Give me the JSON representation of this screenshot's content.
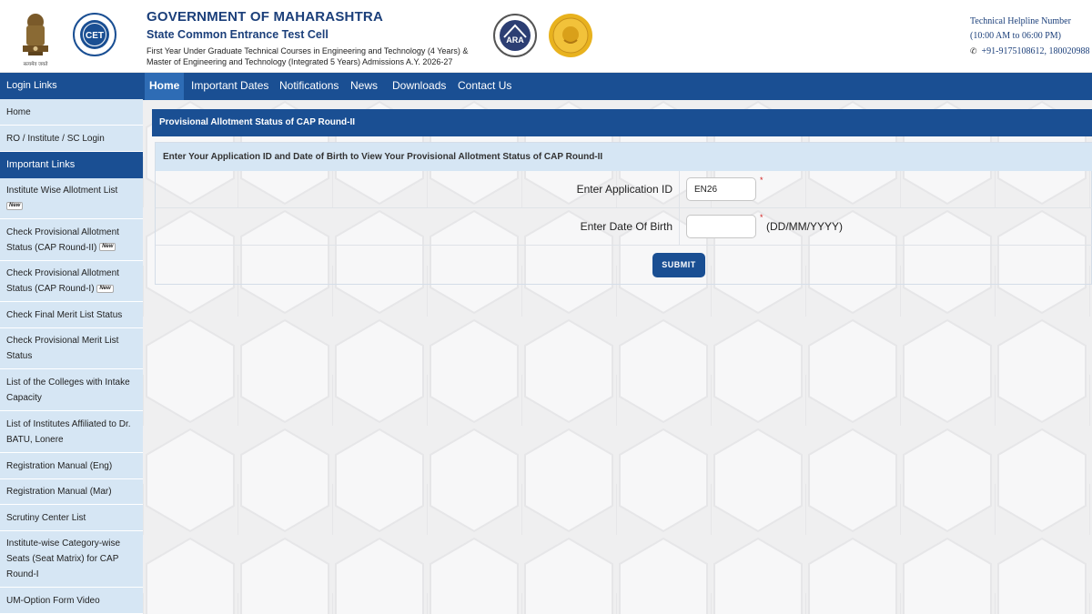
{
  "header": {
    "gov_title": "GOVERNMENT OF MAHARASHTRA",
    "cell_title": "State Common Entrance Test Cell",
    "description_line1": "First Year Under Graduate Technical Courses in Engineering and Technology (4 Years) &",
    "description_line2": "Master of Engineering and Technology (Integrated 5 Years) Admissions A.Y. 2026-27",
    "emblem_caption": "सत्यमेव जयते",
    "cet_logo_text": "CET",
    "ara_logo_text": "ARA",
    "helpline_title": "Technical Helpline Number",
    "helpline_hours": "(10:00 AM to 06:00 PM)",
    "helpline_numbers": "+91-9175108612, 180020988"
  },
  "nav": {
    "items": [
      "Home",
      "Important Dates",
      "Notifications",
      "News",
      "Downloads",
      "Contact Us"
    ],
    "active": "Home"
  },
  "sidebar": {
    "login_heading": "Login Links",
    "login_items": [
      "Home",
      "RO / Institute / SC Login"
    ],
    "important_heading": "Important Links",
    "important_items": [
      {
        "label": "Institute Wise Allotment List",
        "new": true
      },
      {
        "label": "Check Provisional Allotment Status (CAP Round-II)",
        "new": true
      },
      {
        "label": "Check Provisional Allotment Status (CAP Round-I)",
        "new": true
      },
      {
        "label": "Check Final Merit List Status",
        "new": false
      },
      {
        "label": "Check Provisional Merit List Status",
        "new": false
      },
      {
        "label": "List of the Colleges with Intake Capacity",
        "new": false
      },
      {
        "label": "List of Institutes Affiliated to Dr. BATU, Lonere",
        "new": false
      },
      {
        "label": "Registration Manual (Eng)",
        "new": false
      },
      {
        "label": "Registration Manual (Mar)",
        "new": false
      },
      {
        "label": "Scrutiny Center List",
        "new": false
      },
      {
        "label": "Institute-wise Category-wise Seats (Seat Matrix) for CAP Round-I",
        "new": false
      },
      {
        "label": "UM-Option Form Video",
        "new": false
      }
    ],
    "new_badge": "New"
  },
  "main": {
    "panel_title": "Provisional Allotment Status of CAP Round-II",
    "form_subtitle": "Enter Your Application ID and Date of Birth to View Your Provisional Allotment Status of CAP Round-II",
    "application_id_label": "Enter Application ID",
    "application_id_value": "EN26",
    "dob_label": "Enter Date Of Birth",
    "dob_value": "",
    "dob_format": "(DD/MM/YYYY)",
    "required_mark": "*",
    "submit_label": "SUBMIT"
  },
  "colors": {
    "primary_blue": "#1a4f93",
    "sidebar_bg": "#d6e6f4",
    "title_blue": "#1b3f7a",
    "required_red": "#d02020"
  }
}
